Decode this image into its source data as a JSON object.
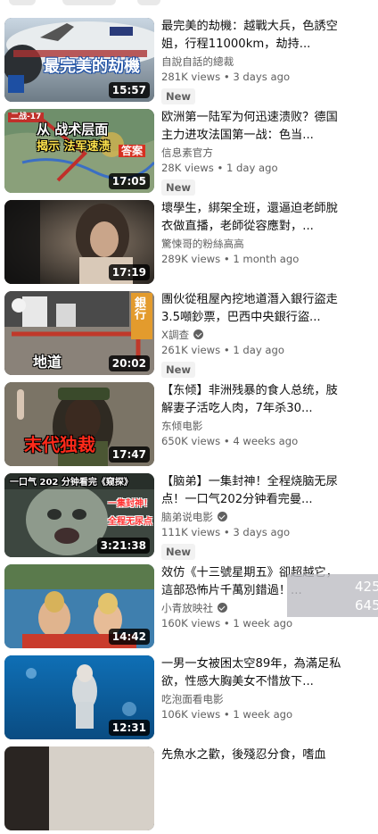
{
  "videos": [
    {
      "title": "最完美的劫機：越戰大兵，色誘空姐，行程11000km，劫持...",
      "channel": "自說自話的總裁",
      "verified": false,
      "stats": "281K views • 3 days ago",
      "badge": "New",
      "duration": "15:57",
      "overlay": [
        "最完美的劫機"
      ],
      "thumb_theme": "plane"
    },
    {
      "title": "欧洲第一陆军为何迅速溃败？德国主力进攻法国第一战：色当...",
      "channel": "信息素官方",
      "verified": false,
      "stats": "28K views • 1 day ago",
      "badge": "New",
      "duration": "17:05",
      "overlay": [
        "二战-17",
        "从 战术层面",
        "揭示 法军速溃",
        "答案"
      ],
      "thumb_theme": "map"
    },
    {
      "title": "壞學生，綁架全班，還逼迫老師脫衣做直播，老師從容應對，...",
      "channel": "驚悚哥的粉絲高高",
      "verified": false,
      "stats": "289K views • 1 month ago",
      "badge": "",
      "duration": "17:19",
      "overlay": [],
      "thumb_theme": "dark"
    },
    {
      "title": "團伙從租屋內挖地道潛入銀行盜走3.5噸鈔票，巴西中央銀行盜...",
      "channel": "X調查",
      "verified": true,
      "stats": "261K views • 1 day ago",
      "badge": "New",
      "duration": "20:02",
      "overlay": [
        "地道",
        "銀行"
      ],
      "thumb_theme": "tunnel"
    },
    {
      "title": "【东倾】非洲残暴的食人总统，肢解妻子活吃人肉，7年杀30...",
      "channel": "东倾电影",
      "verified": false,
      "stats": "650K views • 4 weeks ago",
      "badge": "",
      "duration": "17:47",
      "overlay": [
        "末代独裁"
      ],
      "thumb_theme": "dictator"
    },
    {
      "title": "【脑弟】一集封神！全程烧脑无尿点！一口气202分钟看完曼...",
      "channel": "脑弟说电影",
      "verified": true,
      "stats": "111K views • 3 days ago",
      "badge": "New",
      "duration": "3:21:38",
      "overlay": [
        "一口气 202 分钟看完《窥探》",
        "一集封神！",
        "全程无尿点"
      ],
      "thumb_theme": "baby"
    },
    {
      "title": "效仿《十三號星期五》卻超越它，這部恐怖片千萬別錯過！...",
      "channel": "小青放映社",
      "verified": true,
      "stats": "160K views • 1 week ago",
      "badge": "",
      "duration": "14:42",
      "overlay": [],
      "thumb_theme": "lake"
    },
    {
      "title": "一男一女被困太空89年，為滿足私欲，性感大胸美女不惜放下...",
      "channel": "吃泡面看电影",
      "verified": false,
      "stats": "106K views • 1 week ago",
      "badge": "",
      "duration": "12:31",
      "overlay": [],
      "thumb_theme": "water"
    },
    {
      "title": "先魚水之歡，後殘忍分食，嗜血",
      "channel": "",
      "verified": false,
      "stats": "",
      "badge": "",
      "duration": "",
      "overlay": [],
      "thumb_theme": "partial"
    }
  ],
  "popup": {
    "line1": "425",
    "line2": "645"
  },
  "colors": {
    "title": "#0f0f0f",
    "meta": "#606060",
    "badge_bg": "#f2f2f2",
    "duration_bg": "#000000"
  }
}
